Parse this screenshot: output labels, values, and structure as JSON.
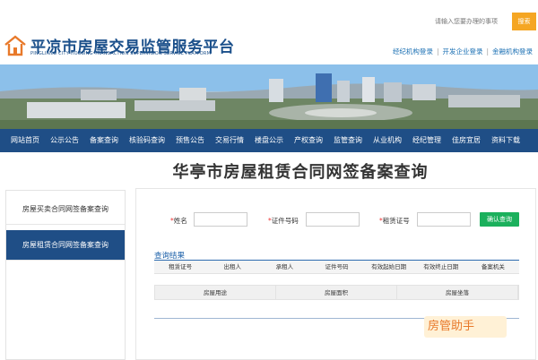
{
  "search": {
    "placeholder": "请输入您要办理的事项",
    "button_label": "搜索"
  },
  "header": {
    "title": "平凉市房屋交易监管服务平台",
    "subtitle": "PINGLIANG CITY HOUSING TRANSACTION SUPERVISION SERVICE PLATFORM",
    "login_links": [
      "经纪机构登录",
      "开发企业登录",
      "金融机构登录"
    ]
  },
  "nav": {
    "items": [
      "网站首页",
      "公示公告",
      "备案查询",
      "核验码查询",
      "预售公告",
      "交易行情",
      "楼盘公示",
      "产权查询",
      "监管查询",
      "从业机构",
      "经纪管理",
      "佳房宜居",
      "资料下载"
    ]
  },
  "page_title": "华亭市房屋租赁合同网签备案查询",
  "sidebar": {
    "items": [
      {
        "label": "房屋买卖合同网签备案查询",
        "active": false
      },
      {
        "label": "房屋租赁合同网签备案查询",
        "active": true
      }
    ]
  },
  "form": {
    "name_label": "姓名",
    "id_label": "证件号码",
    "cert_label": "租赁证号",
    "query_button": "确认查询"
  },
  "results": {
    "title": "查询结果",
    "columns": [
      "租赁证号",
      "出租人",
      "承租人",
      "证件号码",
      "有效起始日期",
      "有效终止日期",
      "备案机关"
    ],
    "columns2": [
      "房屋用途",
      "房屋面积",
      "房屋坐落"
    ]
  },
  "watermark": "房管助手",
  "colors": {
    "nav_bg": "#1f4e86",
    "accent_green": "#1bb05c",
    "search_orange": "#f5a623"
  }
}
